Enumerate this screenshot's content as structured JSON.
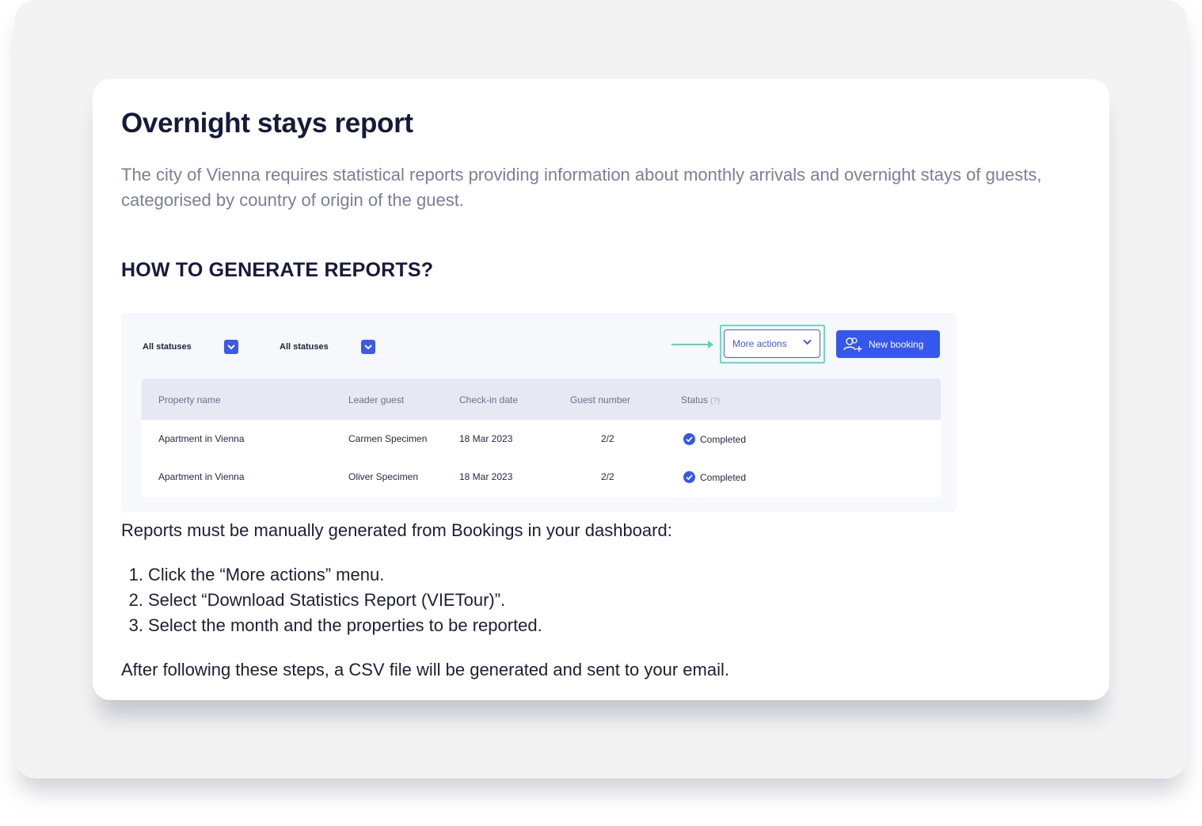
{
  "title": "Overnight stays report",
  "intro": "The city of Vienna requires statistical reports providing information about monthly arrivals and overnight stays of guests, categorised by country of origin of the guest.",
  "how_heading": "HOW TO GENERATE REPORTS?",
  "mock": {
    "filters": [
      {
        "label": "All statuses",
        "icon": "chevron-down-icon"
      },
      {
        "label": "All statuses",
        "icon": "chevron-down-icon"
      }
    ],
    "more_actions_label": "More actions",
    "new_booking_label": "New booking",
    "new_booking_icon": "add-user-icon",
    "highlight_color": "#6dd9bd",
    "accent_color": "#3557ee",
    "table": {
      "headers": [
        "Property name",
        "Leader guest",
        "Check-in date",
        "Guest number",
        "Status"
      ],
      "status_help": "(?)",
      "rows": [
        {
          "property": "Apartment in Vienna",
          "leader": "Carmen Specimen",
          "checkin": "18 Mar 2023",
          "guests": "2/2",
          "status": "Completed"
        },
        {
          "property": "Apartment in Vienna",
          "leader": "Oliver Specimen",
          "checkin": "18 Mar 2023",
          "guests": "2/2",
          "status": "Completed"
        }
      ]
    }
  },
  "instructions_intro": "Reports must be manually generated from Bookings in your dashboard:",
  "steps": [
    {
      "num": "1.",
      "text": "Click the “More actions” menu."
    },
    {
      "num": "2.",
      "text": "Select “Download Statistics Report (VIETour)”."
    },
    {
      "num": "3.",
      "text": "Select the month and the properties to be reported."
    }
  ],
  "closing": "After following these steps, a CSV file will be generated and sent to your email."
}
